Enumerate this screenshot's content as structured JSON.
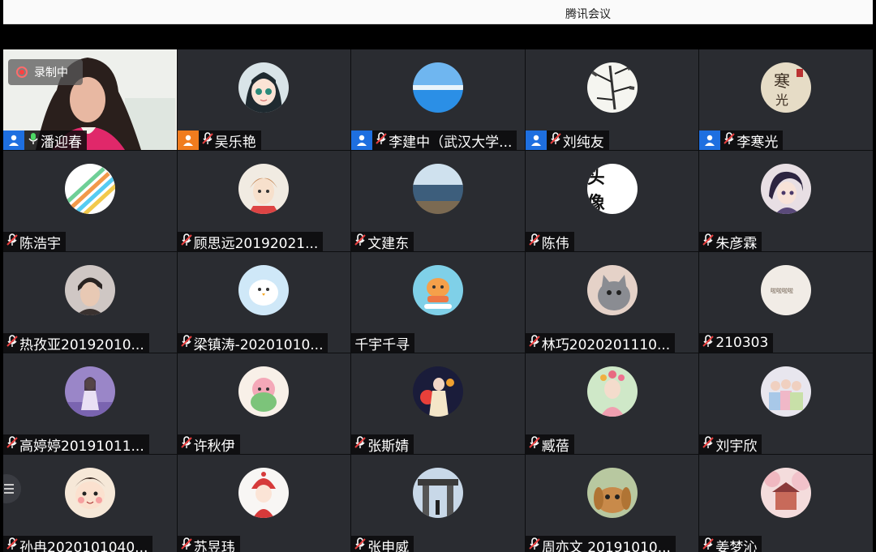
{
  "window": {
    "title": "腾讯会议"
  },
  "recording": {
    "label": "录制中"
  },
  "colors": {
    "tile_bg": "#2a2c31",
    "host_blue": "#1e6fe0",
    "cohost_orange": "#f07c1e",
    "rec_red": "#ff4040"
  },
  "participants": [
    {
      "name": "潘迎春",
      "role": "host",
      "mic": "on",
      "video": true
    },
    {
      "name": "吴乐艳",
      "role": "cohost",
      "mic": "muted",
      "avatar": "anime-girl"
    },
    {
      "name": "李建中（武汉大学...",
      "role": "host",
      "mic": "muted",
      "avatar": "sea-horizon"
    },
    {
      "name": "刘纯友",
      "role": "host",
      "mic": "muted",
      "avatar": "bamboo-painting"
    },
    {
      "name": "李寒光",
      "role": "host",
      "mic": "muted",
      "avatar": "calligraphy"
    },
    {
      "name": "陈浩宇",
      "role": "none",
      "mic": "muted",
      "avatar": "color-stripes"
    },
    {
      "name": "顾思远20192021...",
      "role": "none",
      "mic": "muted",
      "avatar": "anime-boy"
    },
    {
      "name": "文建东",
      "role": "none",
      "mic": "muted",
      "avatar": "lake"
    },
    {
      "name": "陈伟",
      "role": "none",
      "mic": "muted",
      "avatar": "text-avatar",
      "avatar_text": "头 像"
    },
    {
      "name": "朱彦霖",
      "role": "none",
      "mic": "muted",
      "avatar": "anime-detective"
    },
    {
      "name": "热孜亚20192010...",
      "role": "none",
      "mic": "muted",
      "avatar": "portrait-boy"
    },
    {
      "name": "梁镇涛-20201010...",
      "role": "none",
      "mic": "muted",
      "avatar": "cartoon-bird"
    },
    {
      "name": "千宇千寻",
      "role": "none",
      "mic": "none",
      "avatar": "cartoon-tiger"
    },
    {
      "name": "林巧2020201110...",
      "role": "none",
      "mic": "muted",
      "avatar": "cat"
    },
    {
      "name": "210303",
      "role": "none",
      "mic": "muted",
      "avatar": "note"
    },
    {
      "name": "高婷婷20191011...",
      "role": "none",
      "mic": "muted",
      "avatar": "lavender-girl"
    },
    {
      "name": "许秋伊",
      "role": "none",
      "mic": "muted",
      "avatar": "cartoon-frog"
    },
    {
      "name": "张斯婧",
      "role": "none",
      "mic": "muted",
      "avatar": "lantern-girl"
    },
    {
      "name": "臧蓓",
      "role": "none",
      "mic": "muted",
      "avatar": "flower-girl"
    },
    {
      "name": "刘宇欣",
      "role": "none",
      "mic": "muted",
      "avatar": "group-photo"
    },
    {
      "name": "孙冉2020101040...",
      "role": "none",
      "mic": "muted",
      "avatar": "cartoon-face"
    },
    {
      "name": "苏昱玮",
      "role": "none",
      "mic": "muted",
      "avatar": "red-hat-girl"
    },
    {
      "name": "张申威",
      "role": "none",
      "mic": "muted",
      "avatar": "gate"
    },
    {
      "name": "周亦文 20191010...",
      "role": "none",
      "mic": "muted",
      "avatar": "rabbit"
    },
    {
      "name": "姜梦沁",
      "role": "none",
      "mic": "muted",
      "avatar": "pink-building"
    }
  ]
}
